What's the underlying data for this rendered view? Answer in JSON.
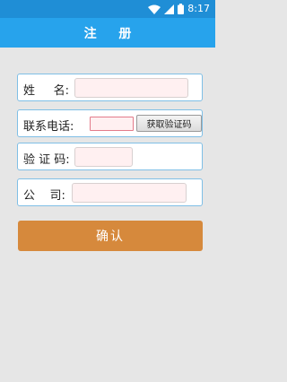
{
  "status_bar": {
    "time": "8:17",
    "icons": [
      "wifi-icon",
      "cellular-signal-icon",
      "battery-icon"
    ]
  },
  "header": {
    "title": "注 册"
  },
  "form": {
    "name": {
      "label": "姓     名:",
      "value": "",
      "placeholder": ""
    },
    "phone": {
      "label": "联系电话:",
      "value": "",
      "placeholder": ""
    },
    "get_code_label": "获取验证码",
    "code": {
      "label": "验 证 码:",
      "value": "",
      "placeholder": ""
    },
    "company": {
      "label": "公    司:",
      "value": "",
      "placeholder": ""
    }
  },
  "confirm_label": "确认",
  "colors": {
    "status_bar": "#1f8ed6",
    "title_bar": "#27a3ec",
    "background": "#e6e6e6",
    "card_border": "#7fbfe6",
    "input_fill": "#fff0f1",
    "confirm_button": "#d6893c"
  }
}
